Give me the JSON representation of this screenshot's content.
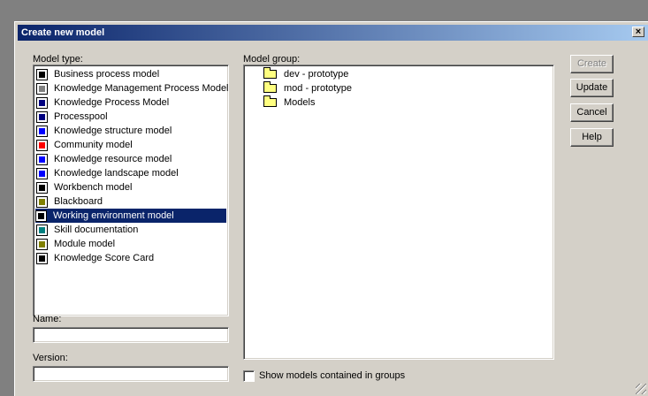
{
  "dialog": {
    "title": "Create new model",
    "close_label": "×"
  },
  "model_type": {
    "label": "Model type:",
    "items": [
      {
        "label": "Business process model",
        "icon": "triangle-icon",
        "color": "#000000"
      },
      {
        "label": "Knowledge Management Process Model",
        "icon": "process-icon",
        "color": "#808080"
      },
      {
        "label": "Knowledge Process Model",
        "icon": "knowledge-process-icon",
        "color": "#000080"
      },
      {
        "label": "Processpool",
        "icon": "processpool-icon",
        "color": "#000080"
      },
      {
        "label": "Knowledge structure model",
        "icon": "structure-icon",
        "color": "#0000ff"
      },
      {
        "label": "Community model",
        "icon": "community-icon",
        "color": "#ff0000"
      },
      {
        "label": "Knowledge resource model",
        "icon": "resource-icon",
        "color": "#0000ff"
      },
      {
        "label": "Knowledge landscape model",
        "icon": "landscape-icon",
        "color": "#0000ff"
      },
      {
        "label": "Workbench model",
        "icon": "workbench-icon",
        "color": "#000000"
      },
      {
        "label": "Blackboard",
        "icon": "blackboard-icon",
        "color": "#808000"
      },
      {
        "label": "Working environment model",
        "icon": "working-environment-icon",
        "color": "#000000"
      },
      {
        "label": "Skill documentation",
        "icon": "skill-icon",
        "color": "#008080"
      },
      {
        "label": "Module model",
        "icon": "module-icon",
        "color": "#808000"
      },
      {
        "label": "Knowledge Score Card",
        "icon": "scorecard-icon",
        "color": "#000000"
      }
    ],
    "selected_index": 10
  },
  "model_group": {
    "label": "Model group:",
    "items": [
      {
        "label": "dev - prototype",
        "icon": "folder-icon"
      },
      {
        "label": "mod - prototype",
        "icon": "folder-icon"
      },
      {
        "label": "Models",
        "icon": "folder-icon"
      }
    ]
  },
  "name": {
    "label": "Name:",
    "value": ""
  },
  "version": {
    "label": "Version:",
    "value": ""
  },
  "show_models": {
    "label": "Show models contained in groups",
    "checked": false
  },
  "buttons": {
    "create": "Create",
    "update": "Update",
    "cancel": "Cancel",
    "help": "Help"
  }
}
